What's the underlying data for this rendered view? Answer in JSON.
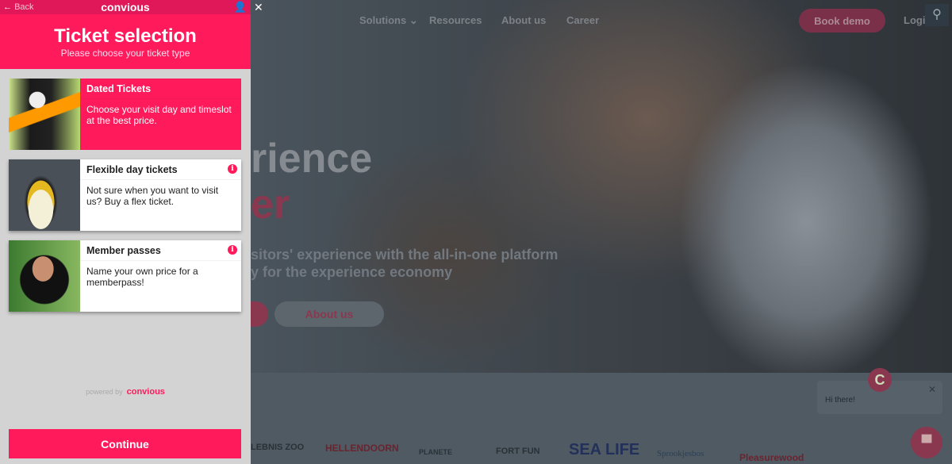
{
  "panel": {
    "back": "Back",
    "brand": "convious",
    "title": "Ticket selection",
    "subtitle": "Please choose your ticket type",
    "tickets": [
      {
        "title": "Dated Tickets",
        "desc": "Choose your visit day and timeslot at the best price.",
        "selected": true
      },
      {
        "title": "Flexible day tickets",
        "desc": "Not sure when you want to visit us? Buy a flex ticket.",
        "selected": false
      },
      {
        "title": "Member passes",
        "desc": "Name your own price for a memberpass!",
        "selected": false
      }
    ],
    "powered_by": "powered by",
    "powered_brand": "convious",
    "continue": "Continue"
  },
  "site": {
    "nav": [
      "Solutions",
      "Resources",
      "About us",
      "Career"
    ],
    "book_demo": "Book demo",
    "login": "Logi",
    "hero_line1": "rience",
    "hero_line2": "er",
    "hero_text1": "sitors' experience with the all-in-one platform",
    "hero_text2": "y for the experience economy",
    "about_btn": "About us",
    "chat_text": "Hi there!",
    "chat_avatar": "C",
    "logos": [
      "LEBNIS ZOO",
      "HELLENDOORN",
      "PLANETE",
      "FORT FUN",
      "SEA LIFE",
      "Sprookjesbos",
      "Pleasurewood"
    ]
  },
  "colors": {
    "accent": "#ff1a5c",
    "accent_dark": "#e0185a"
  }
}
